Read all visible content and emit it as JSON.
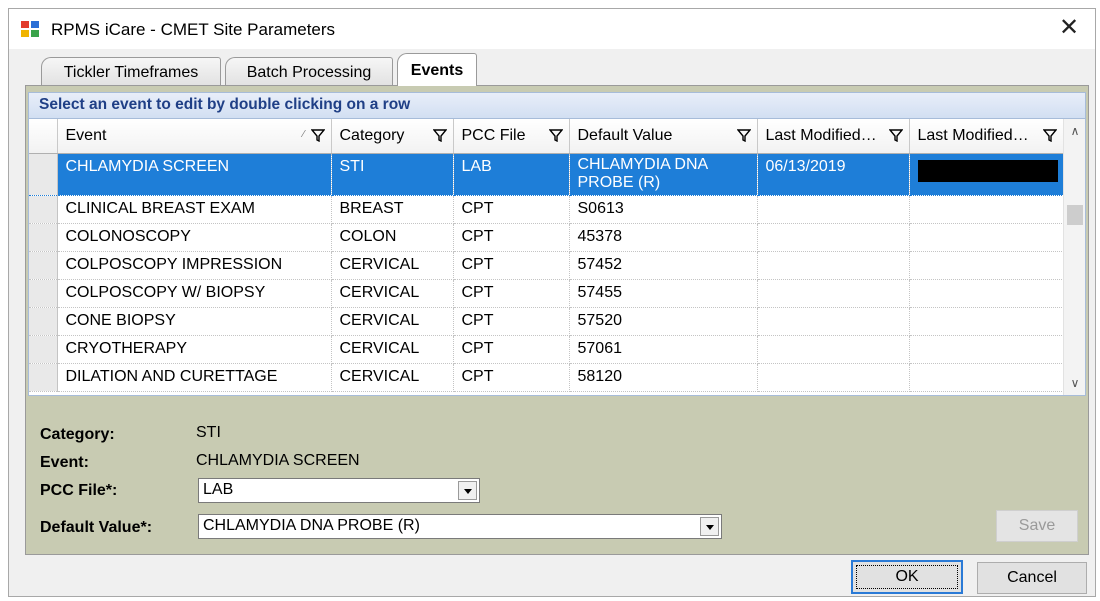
{
  "window": {
    "title": "RPMS iCare - CMET Site Parameters",
    "close_glyph": "✕",
    "icon": "app-window-icon"
  },
  "tabs": [
    {
      "label": "Tickler Timeframes",
      "active": false
    },
    {
      "label": "Batch Processing",
      "active": false
    },
    {
      "label": "Events",
      "active": true
    }
  ],
  "grid": {
    "caption": "Select an event to edit by double clicking on a row",
    "columns": [
      "Event",
      "Category",
      "PCC File",
      "Default Value",
      "Last Modified…",
      "Last Modified…"
    ],
    "sort_glyph": "⁄",
    "rows": [
      {
        "event": "CHLAMYDIA SCREEN",
        "category": "STI",
        "pcc_file": "LAB",
        "default_value": "CHLAMYDIA DNA PROBE (R)",
        "last_modified_date": "06/13/2019",
        "last_modified_by": "[redacted]",
        "selected": true
      },
      {
        "event": "CLINICAL BREAST EXAM",
        "category": "BREAST",
        "pcc_file": "CPT",
        "default_value": "S0613",
        "last_modified_date": "",
        "last_modified_by": ""
      },
      {
        "event": "COLONOSCOPY",
        "category": "COLON",
        "pcc_file": "CPT",
        "default_value": "45378",
        "last_modified_date": "",
        "last_modified_by": ""
      },
      {
        "event": "COLPOSCOPY IMPRESSION",
        "category": "CERVICAL",
        "pcc_file": "CPT",
        "default_value": "57452",
        "last_modified_date": "",
        "last_modified_by": ""
      },
      {
        "event": "COLPOSCOPY W/ BIOPSY",
        "category": "CERVICAL",
        "pcc_file": "CPT",
        "default_value": "57455",
        "last_modified_date": "",
        "last_modified_by": ""
      },
      {
        "event": "CONE BIOPSY",
        "category": "CERVICAL",
        "pcc_file": "CPT",
        "default_value": "57520",
        "last_modified_date": "",
        "last_modified_by": ""
      },
      {
        "event": "CRYOTHERAPY",
        "category": "CERVICAL",
        "pcc_file": "CPT",
        "default_value": "57061",
        "last_modified_date": "",
        "last_modified_by": ""
      },
      {
        "event": "DILATION AND CURETTAGE",
        "category": "CERVICAL",
        "pcc_file": "CPT",
        "default_value": "58120",
        "last_modified_date": "",
        "last_modified_by": ""
      }
    ],
    "scroll_up_glyph": "∧",
    "scroll_down_glyph": "∨"
  },
  "detail": {
    "category_label": "Category:",
    "category_value": "STI",
    "event_label": "Event:",
    "event_value": "CHLAMYDIA SCREEN",
    "pcc_file_label": "PCC File*:",
    "pcc_file_value": "LAB",
    "default_value_label": "Default Value*:",
    "default_value_value": "CHLAMYDIA DNA PROBE (R)",
    "save_label": "Save"
  },
  "footer": {
    "ok_label": "OK",
    "cancel_label": "Cancel"
  },
  "colors": {
    "selection": "#1e7ed8",
    "caption_text": "#1f3f86",
    "panel_background": "#c8cbb2"
  }
}
